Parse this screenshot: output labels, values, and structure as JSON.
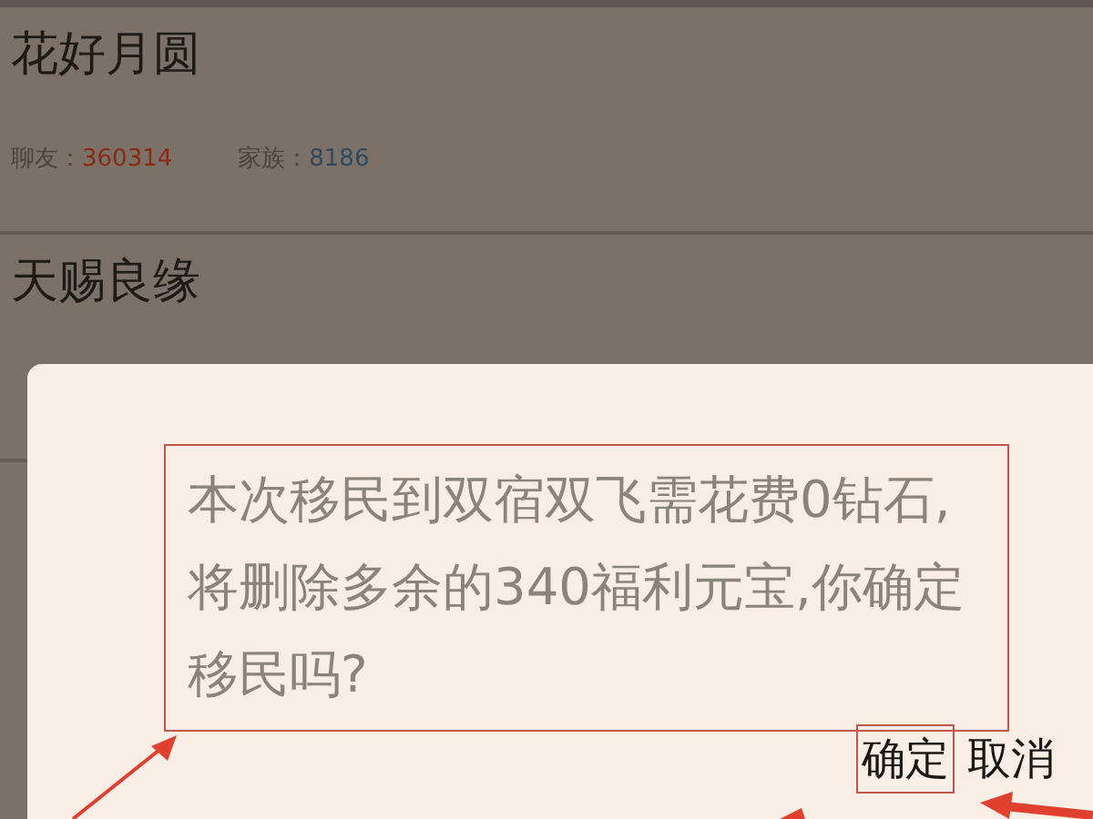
{
  "groups": [
    {
      "name": "花好月圆",
      "stats": [
        {
          "label": "聊友：",
          "value": "360314",
          "color": "#8a2a10"
        },
        {
          "label": "家族：",
          "value": "8186",
          "color": "#2f4a60"
        }
      ]
    },
    {
      "name": "天赐良缘"
    }
  ],
  "dialog": {
    "message": "本次移民到双宿双飞需花费0钻石,将删除多余的340福利元宝,你确定移民吗?",
    "buttons": [
      {
        "label": "确定",
        "highlighted": true
      },
      {
        "label": "取消",
        "highlighted": false
      }
    ]
  }
}
